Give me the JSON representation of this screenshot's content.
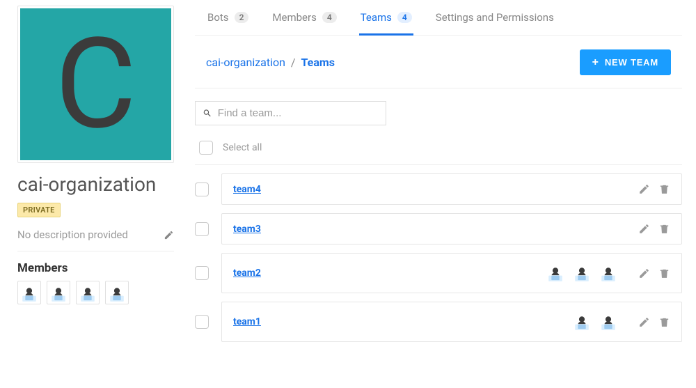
{
  "org": {
    "initial": "C",
    "name": "cai-organization",
    "privacy_badge": "PRIVATE",
    "description_placeholder": "No description provided",
    "members_heading": "Members",
    "member_count": 4
  },
  "tabs": [
    {
      "label": "Bots",
      "count": "2"
    },
    {
      "label": "Members",
      "count": "4"
    },
    {
      "label": "Teams",
      "count": "4"
    },
    {
      "label": "Settings and Permissions"
    }
  ],
  "breadcrumb": {
    "root": "cai-organization",
    "separator": "/",
    "current": "Teams"
  },
  "new_team_button": "NEW TEAM",
  "search": {
    "placeholder": "Find a team..."
  },
  "select_all_label": "Select all",
  "teams": [
    {
      "name": "team4",
      "members": 0
    },
    {
      "name": "team3",
      "members": 0
    },
    {
      "name": "team2",
      "members": 3
    },
    {
      "name": "team1",
      "members": 2
    }
  ]
}
